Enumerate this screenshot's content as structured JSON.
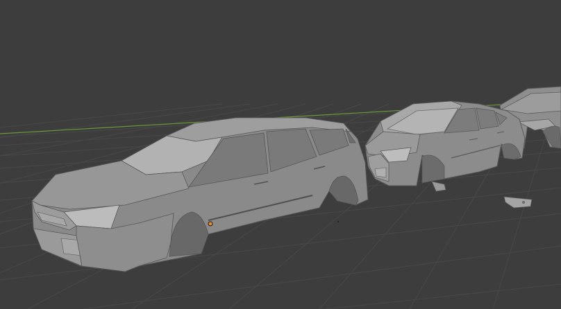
{
  "viewport": {
    "background_color": "#3d3d3d",
    "grid_line_color": "#4a4a4a",
    "x_axis_color": "#6a9a3a"
  },
  "scene": {
    "objects": [
      {
        "name": "station-wagon",
        "color": "#8a8a8a"
      },
      {
        "name": "sedan",
        "color": "#8a8a8a"
      },
      {
        "name": "partial-car-right",
        "color": "#8a8a8a"
      },
      {
        "name": "detached-part-small",
        "color": "#8a8a8a"
      },
      {
        "name": "detached-part-right",
        "color": "#8a8a8a"
      }
    ],
    "origin_marker_color": "#f08a1a"
  }
}
